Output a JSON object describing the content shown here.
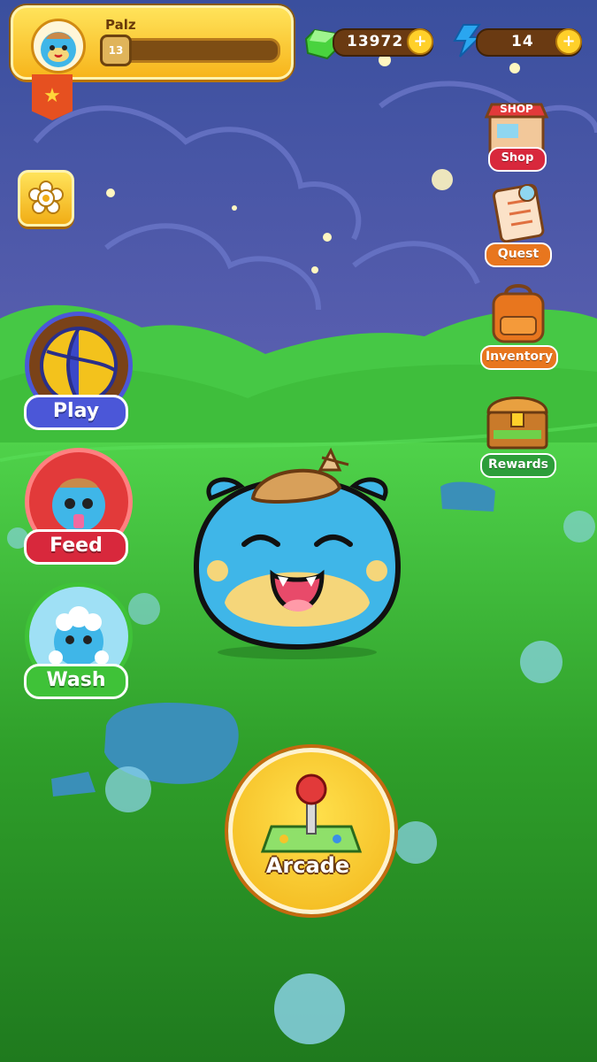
{
  "player": {
    "name": "Palz",
    "level": "13",
    "xp_fraction": 0.02
  },
  "currency": {
    "gems": {
      "icon": "green-gem-icon",
      "value": "13972"
    },
    "energy": {
      "icon": "blue-lightning-icon",
      "value": "14"
    }
  },
  "actions": {
    "play": "Play",
    "feed": "Feed",
    "wash": "Wash",
    "arcade": "Arcade"
  },
  "menu": {
    "shop": "Shop",
    "shop_sign": "SHOP",
    "quest": "Quest",
    "inventory": "Inventory",
    "rewards": "Rewards"
  },
  "colors": {
    "play": "#4b57d8",
    "feed": "#d8283c",
    "wash": "#3fc238",
    "menu_label": "#e8761e",
    "rewards": "#2d9e3a"
  }
}
